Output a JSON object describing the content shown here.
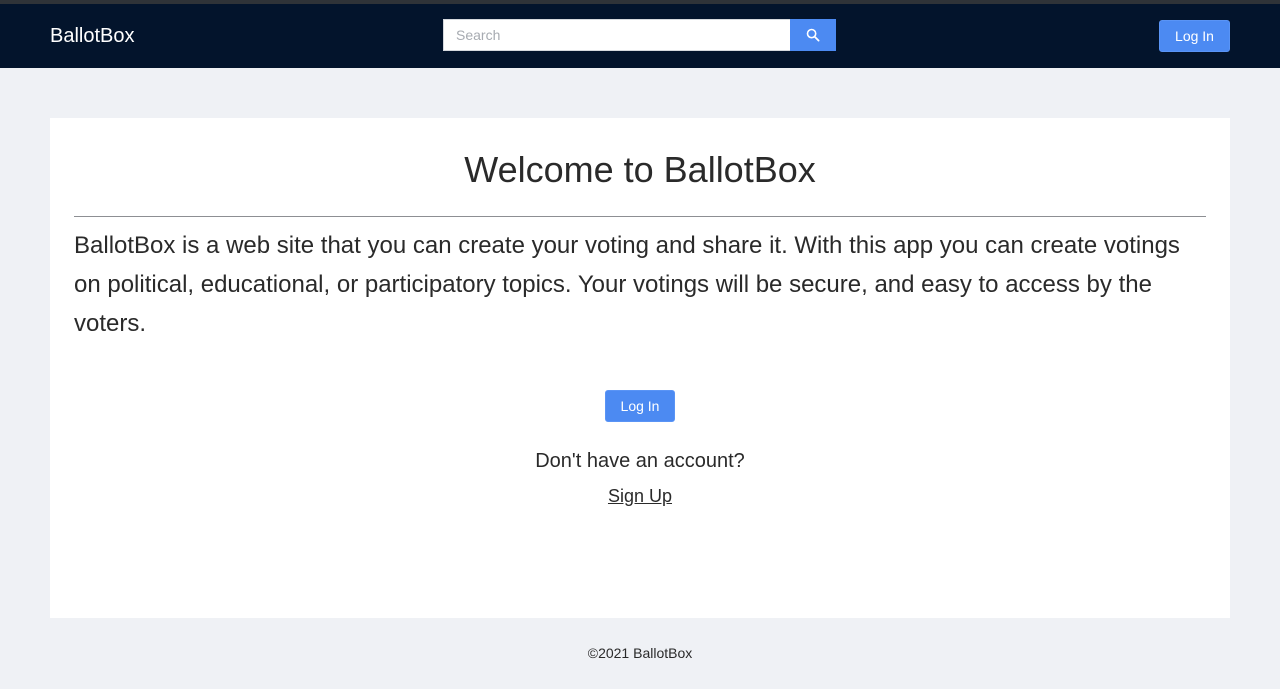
{
  "navbar": {
    "brand": "BallotBox",
    "search": {
      "placeholder": "Search",
      "value": "",
      "icon": "search-icon"
    },
    "login_label": "Log In",
    "accent_color": "#4c8af2",
    "background_color": "#03142c"
  },
  "main": {
    "title": "Welcome to BallotBox",
    "description": "BallotBox is a web site that you can create your voting and share it. With this app you can create votings on political, educational, or participatory topics. Your votings will be secure, and easy to access by the voters.",
    "login_label": "Log In",
    "no_account_text": "Don't have an account?",
    "signup_label": "Sign Up"
  },
  "footer": {
    "copyright": "©2021 BallotBox"
  }
}
